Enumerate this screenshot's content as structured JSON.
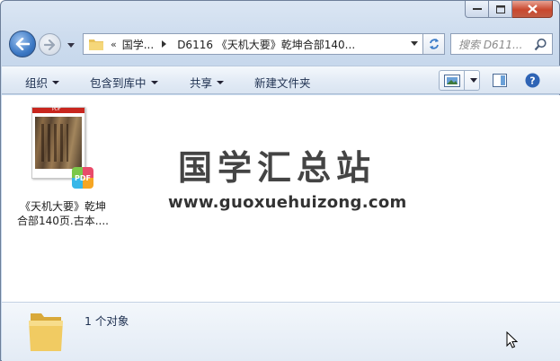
{
  "window": {
    "caption_buttons": [
      "minimize",
      "maximize",
      "close"
    ]
  },
  "nav": {
    "address": {
      "overflow_chevron": "«",
      "crumbs": [
        "国学...",
        "D6116 《天机大要》乾坤合部140..."
      ]
    },
    "search": {
      "placeholder": "搜索 D611..."
    }
  },
  "commands": {
    "organize": "组织",
    "include_in_library": "包含到库中",
    "share": "共享",
    "new_folder": "新建文件夹"
  },
  "files": [
    {
      "name_line1": "《天机大要》乾坤",
      "name_line2": "合部140页.古本....",
      "thumb_header": "PDF",
      "badge": "PDF"
    }
  ],
  "watermark": {
    "title": "国学汇总站",
    "url": "www.guoxuehuizong.com"
  },
  "details": {
    "count": "1 个对象"
  },
  "colors": {
    "accent": "#3b78c4",
    "close": "#c9482e",
    "pdf_red": "#c8261e"
  }
}
